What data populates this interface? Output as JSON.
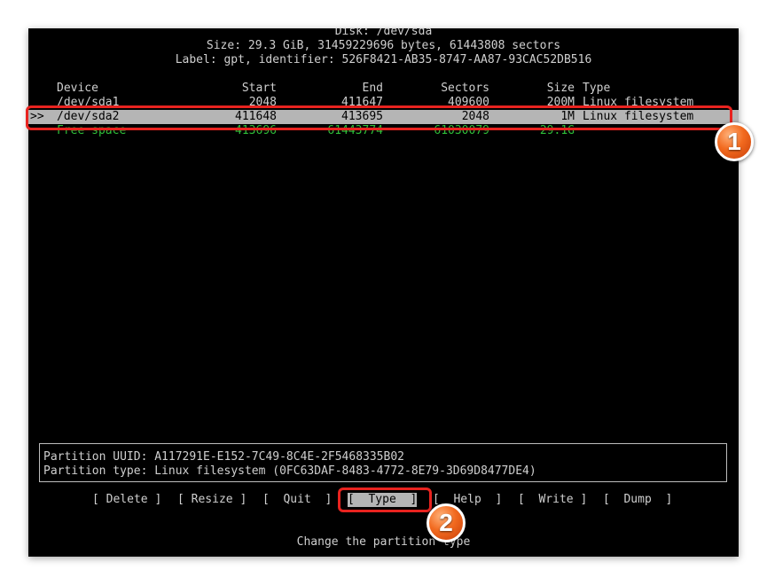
{
  "header": {
    "disk_line": "Disk: /dev/sda",
    "size_line": "Size: 29.3 GiB, 31459229696 bytes, 61443808 sectors",
    "label_line": "Label: gpt, identifier: 526F8421-AB35-8747-AA87-93CAC52DB516"
  },
  "table": {
    "columns": {
      "device": "Device",
      "start": "Start",
      "end": "End",
      "sectors": "Sectors",
      "size": "Size",
      "type": "Type"
    },
    "rows": [
      {
        "cursor": "",
        "device": "/dev/sda1",
        "start": "2048",
        "end": "411647",
        "sectors": "409600",
        "size": "200M",
        "type": "Linux filesystem"
      },
      {
        "cursor": ">>",
        "device": "/dev/sda2",
        "start": "411648",
        "end": "413695",
        "sectors": "2048",
        "size": "1M",
        "type": "Linux filesystem"
      },
      {
        "cursor": "",
        "device": "Free space",
        "start": "413696",
        "end": "61443774",
        "sectors": "61030079",
        "size": "29.1G",
        "type": ""
      }
    ]
  },
  "info": {
    "uuid_line": "Partition UUID: A117291E-E152-7C49-8C4E-2F5468335B02",
    "type_line": "Partition type: Linux filesystem (0FC63DAF-8483-4772-8E79-3D69D8477DE4)"
  },
  "menu": {
    "delete": "[ Delete ]",
    "resize": "[ Resize ]",
    "quit": "[  Quit  ]",
    "type": "[  Type  ]",
    "help": "[  Help  ]",
    "write": "[  Write ]",
    "dump": "[  Dump  ]"
  },
  "status": "Change the partition type",
  "annotations": {
    "badge1": "1",
    "badge2": "2",
    "color": "#e8231f"
  }
}
